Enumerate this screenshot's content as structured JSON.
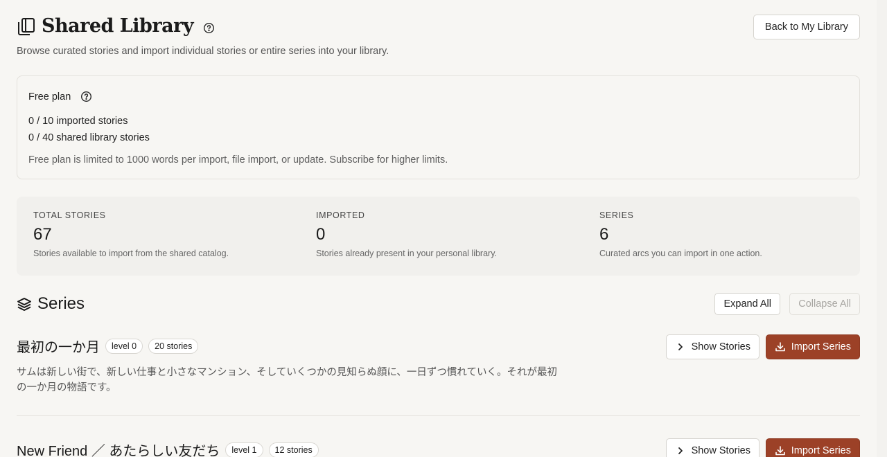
{
  "header": {
    "title": "Shared Library",
    "subtitle": "Browse curated stories and import individual stories or entire series into your library.",
    "back_label": "Back to My Library"
  },
  "plan": {
    "name": "Free plan",
    "imported": "0 / 10 imported stories",
    "shared": "0 / 40 shared library stories",
    "note": "Free plan is limited to 1000 words per import, file import, or update. Subscribe for higher limits."
  },
  "stats": [
    {
      "label": "TOTAL STORIES",
      "value": "67",
      "desc": "Stories available to import from the shared catalog."
    },
    {
      "label": "IMPORTED",
      "value": "0",
      "desc": "Stories already present in your personal library."
    },
    {
      "label": "SERIES",
      "value": "6",
      "desc": "Curated arcs you can import in one action."
    }
  ],
  "series_section": {
    "title": "Series",
    "expand_label": "Expand All",
    "collapse_label": "Collapse All"
  },
  "series": [
    {
      "name": "最初の一か月",
      "level": "level 0",
      "count": "20 stories",
      "desc": "サムは新しい街で、新しい仕事と小さなマンション、そしていくつかの見知らぬ顔に、一日ずつ慣れていく。それが最初の一か月の物語です。",
      "show_label": "Show Stories",
      "import_label": "Import Series"
    },
    {
      "name": "New Friend ／ あたらしい友だち",
      "level": "level 1",
      "count": "12 stories",
      "show_label": "Show Stories",
      "import_label": "Import Series"
    }
  ],
  "colors": {
    "background": "#f7f6f3",
    "accent": "#9c4127"
  }
}
